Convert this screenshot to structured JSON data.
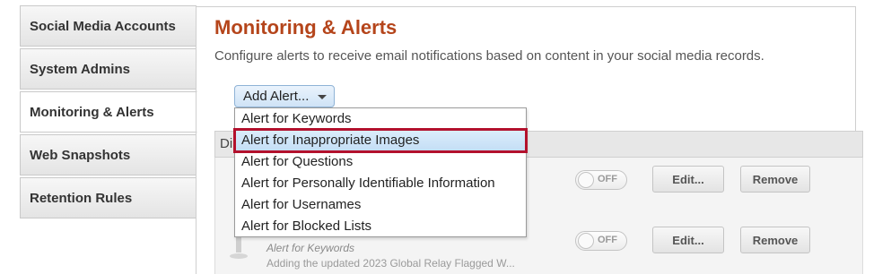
{
  "sidebar": {
    "items": [
      {
        "label": "Social Media Accounts"
      },
      {
        "label": "System Admins"
      },
      {
        "label": "Monitoring & Alerts"
      },
      {
        "label": "Web Snapshots"
      },
      {
        "label": "Retention Rules"
      }
    ],
    "active": "Monitoring & Alerts"
  },
  "main": {
    "title": "Monitoring & Alerts",
    "description": "Configure alerts to receive email notifications based on content in your social media records.",
    "add_alert_label": "Add Alert...",
    "table_header_partial": "Di",
    "rows": [
      {
        "toggle": "OFF",
        "edit": "Edit...",
        "remove": "Remove"
      },
      {
        "toggle": "OFF",
        "edit": "Edit...",
        "remove": "Remove",
        "type": "Alert for Keywords",
        "desc": "Adding the updated 2023 Global Relay Flagged W..."
      }
    ]
  },
  "dropdown": {
    "items": [
      {
        "label": "Alert for Keywords"
      },
      {
        "label": "Alert for Inappropriate Images"
      },
      {
        "label": "Alert for Questions"
      },
      {
        "label": "Alert for Personally Identifiable Information"
      },
      {
        "label": "Alert for Usernames"
      },
      {
        "label": "Alert for Blocked Lists"
      }
    ],
    "highlighted": "Alert for Inappropriate Images"
  },
  "colors": {
    "title": "#b5451b",
    "highlight_border": "#b3112d",
    "highlight_bg": "#cfe4f7"
  }
}
